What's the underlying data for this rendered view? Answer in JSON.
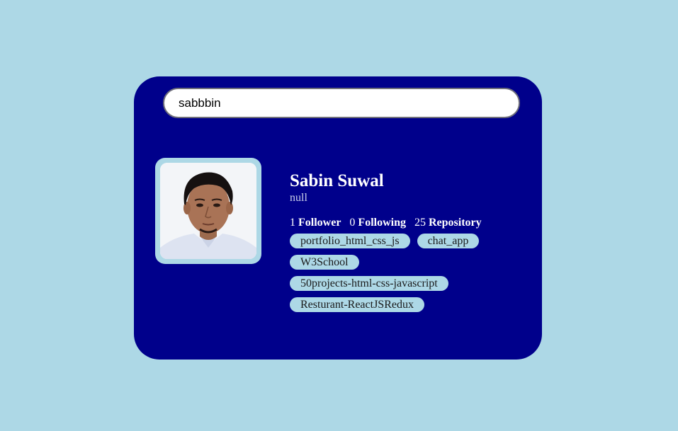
{
  "search": {
    "value": "sabbbin"
  },
  "profile": {
    "name": "Sabin Suwal",
    "bio": "null",
    "avatar_alt": "avatar",
    "stats": {
      "followers_count": "1",
      "followers_label": "Follower",
      "following_count": "0",
      "following_label": "Following",
      "repos_count": "25",
      "repos_label": "Repository"
    },
    "repos": [
      "portfolio_html_css_js",
      "chat_app",
      "W3School",
      "50projects-html-css-javascript",
      "Resturant-ReactJSRedux"
    ]
  },
  "colors": {
    "background": "#add8e6",
    "card": "#00008b",
    "repo_chip": "#add8e6"
  }
}
